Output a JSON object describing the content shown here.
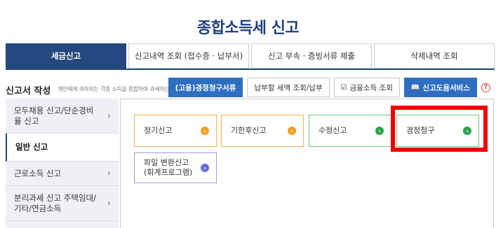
{
  "page": {
    "title": "종합소득세 신고"
  },
  "tabs": [
    {
      "label": "세금신고",
      "active": true
    },
    {
      "label": "신고내역 조회 (접수증 · 납부서)",
      "active": false
    },
    {
      "label": "신고 부속 · 증빙서류 제출",
      "active": false
    },
    {
      "label": "삭제내역 조회",
      "active": false
    }
  ],
  "section": {
    "title": "신고서 작성",
    "description": "개인에게 귀속되는 각종 소득을 종합하여 과세하는 소득세"
  },
  "actions": {
    "claim_docs": "(고용)경정청구서류",
    "tax_payment": "납부할 세액 조회/납부",
    "financial_income": "금융소득 조회",
    "help_service": "신고도움서비스",
    "help_mark": "?"
  },
  "sidebar": {
    "items": [
      {
        "label": "모두채용 신고/단순경비율 신고",
        "active": false
      },
      {
        "label": "일반 신고",
        "active": true
      },
      {
        "label": "근로소득 신고",
        "active": false
      },
      {
        "label": "분리과세 신고 주택임대/기타/연금소득",
        "active": false
      }
    ]
  },
  "cards": [
    {
      "label": "정기신고",
      "color": "#f0a028"
    },
    {
      "label": "기한후신고",
      "color": "#f0a028"
    },
    {
      "label": "수정신고",
      "color": "#2ea44f"
    },
    {
      "label": "경정청구",
      "color": "#2ea44f"
    },
    {
      "label": "파일 변환신고 (회계프로그램)",
      "color": "#6a6fd6"
    }
  ],
  "colors": {
    "primary": "#24487f",
    "accent_blue": "#2d6ec0",
    "highlight": "#ee0000"
  }
}
